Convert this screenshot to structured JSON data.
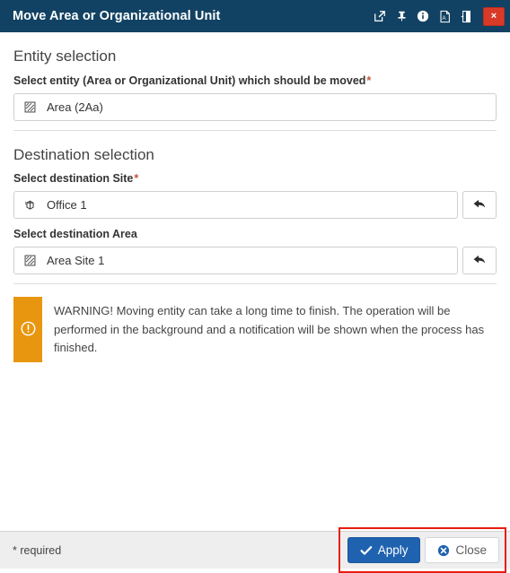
{
  "titlebar": {
    "title": "Move Area or Organizational Unit",
    "icons": [
      {
        "name": "open-in-new-window-icon",
        "label": "Open in new window"
      },
      {
        "name": "pin-icon",
        "label": "Pin"
      },
      {
        "name": "info-icon",
        "label": "Info"
      },
      {
        "name": "pdf-export-icon",
        "label": "Export to PDF"
      },
      {
        "name": "collapse-panel-icon",
        "label": "Collapse"
      }
    ],
    "close_label": "×",
    "background_color": "#124263",
    "close_color": "#d93a28"
  },
  "entity_section": {
    "heading": "Entity selection",
    "field": {
      "label": "Select entity (Area or Organizational Unit) which should be moved",
      "required_marker": "*",
      "required": true,
      "icon": "area-icon",
      "value": "Area (2Aa)",
      "placeholder": "Area (2Aa)"
    }
  },
  "destination_section": {
    "heading": "Destination selection",
    "fields": [
      {
        "label": "Select destination Site",
        "required_marker": "*",
        "required": true,
        "icon": "site-building-icon",
        "value": "Office 1",
        "placeholder": "Office 1",
        "button": {
          "name": "reset-site-button",
          "icon": "undo-arrow-icon"
        }
      },
      {
        "label": "Select destination Area",
        "required_marker": "",
        "required": false,
        "icon": "area-icon",
        "value": "Area Site 1",
        "placeholder": "Area Site 1",
        "button": {
          "name": "reset-area-button",
          "icon": "undo-arrow-icon"
        }
      }
    ]
  },
  "warning": {
    "icon": "exclamation-circle-icon",
    "accent_color": "#e8960f",
    "text": "WARNING! Moving entity can take a long time to finish. The operation will be performed in the background and a notification will be shown when the process has finished."
  },
  "footer": {
    "required_note": "* required",
    "apply_label": "Apply",
    "close_label": "Close",
    "apply_color": "#1f62b0",
    "highlight_color": "#e81d10"
  }
}
